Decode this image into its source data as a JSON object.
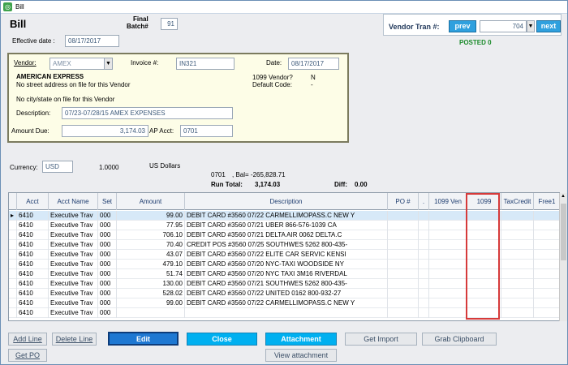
{
  "window": {
    "title": "Bill"
  },
  "header": {
    "heading": "Bill",
    "final_batch_label": "Final\nBatch#",
    "final_batch_value": "91",
    "effective_date_label": "Effective date :",
    "effective_date_value": "08/17/2017"
  },
  "vendor_tran": {
    "label": "Vendor Tran #:",
    "prev_label": "prev",
    "value": "704",
    "next_label": "next",
    "status": "POSTED 0"
  },
  "vendor_box": {
    "vendor_label": "Vendor:",
    "vendor_value": "AMEX",
    "invoice_label": "Invoice #:",
    "invoice_value": "IN321",
    "date_label": "Date:",
    "date_value": "08/17/2017",
    "vendor_name": "AMERICAN EXPRESS",
    "address_line": "No street address on file for this Vendor",
    "city_line": "No city/state on file for this Vendor",
    "vendor1099_label": "1099 Vendor?",
    "vendor1099_value": "N",
    "default_code_label": "Default Code:",
    "default_code_value": "-",
    "description_label": "Description:",
    "description_value": "07/23-07/28/15 AMEX EXPENSES",
    "amount_due_label": "Amount Due:",
    "amount_due_value": "3,174.03",
    "ap_acct_label": "AP Acct:",
    "ap_acct_value": "0701"
  },
  "currency": {
    "label": "Currency:",
    "code": "USD",
    "rate": "1.0000",
    "name": "US Dollars"
  },
  "totals": {
    "acct": "0701",
    "bal": ",  Bal= -265,828.71",
    "run_total_label": "Run Total:",
    "run_total_value": "3,174.03",
    "diff_label": "Diff:",
    "diff_value": "0.00"
  },
  "grid": {
    "columns": [
      "Acct",
      "Acct Name",
      "Set",
      "Amount",
      "Description",
      "PO #",
      ".",
      "1099 Ven",
      "1099",
      "TaxCredit",
      "Free1"
    ],
    "rows": [
      {
        "acct": "6410",
        "name": "Executive Trav",
        "set": "000",
        "amount": "99.00",
        "desc": "DEBIT CARD #3560 07/22 CARMELLIMOPASS.C NEW Y"
      },
      {
        "acct": "6410",
        "name": "Executive Trav",
        "set": "000",
        "amount": "77.95",
        "desc": "DEBIT CARD #3560 07/21 UBER 866-576-1039 CA"
      },
      {
        "acct": "6410",
        "name": "Executive Trav",
        "set": "000",
        "amount": "706.10",
        "desc": "DEBIT CARD #3560 07/21 DELTA AIR 0062 DELTA.C"
      },
      {
        "acct": "6410",
        "name": "Executive Trav",
        "set": "000",
        "amount": "70.40",
        "desc": "CREDIT POS #3560 07/25 SOUTHWES 5262 800-435-"
      },
      {
        "acct": "6410",
        "name": "Executive Trav",
        "set": "000",
        "amount": "43.07",
        "desc": "DEBIT CARD #3560 07/22 ELITE CAR SERVIC KENSI"
      },
      {
        "acct": "6410",
        "name": "Executive Trav",
        "set": "000",
        "amount": "479.10",
        "desc": "DEBIT CARD #3560 07/20 NYC-TAXI WOODSIDE NY"
      },
      {
        "acct": "6410",
        "name": "Executive Trav",
        "set": "000",
        "amount": "51.74",
        "desc": "DEBIT CARD #3560 07/20 NYC TAXI 3M16 RIVERDAL"
      },
      {
        "acct": "6410",
        "name": "Executive Trav",
        "set": "000",
        "amount": "130.00",
        "desc": "DEBIT CARD #3560 07/21 SOUTHWES 5262 800-435-"
      },
      {
        "acct": "6410",
        "name": "Executive Trav",
        "set": "000",
        "amount": "528.02",
        "desc": "DEBIT CARD #3560 07/22 UNITED 0162 800-932-27"
      },
      {
        "acct": "6410",
        "name": "Executive Trav",
        "set": "000",
        "amount": "99.00",
        "desc": "DEBIT CARD #3560 07/22 CARMELLIMOPASS.C NEW Y"
      },
      {
        "acct": "6410",
        "name": "Executive Trav",
        "set": "000",
        "amount": "",
        "desc": ""
      }
    ]
  },
  "buttons": {
    "add_line": "Add Line",
    "delete_line": "Delete Line",
    "edit": "Edit",
    "close": "Close",
    "attachment": "Attachment",
    "get_import": "Get Import",
    "grab_clipboard": "Grab Clipboard",
    "get_po": "Get PO",
    "view_attachment": "View attachment"
  },
  "colors": {
    "button_blue": "#00b0f0",
    "posted_green": "#1a8a2a",
    "highlight_red": "#d63a3a"
  }
}
